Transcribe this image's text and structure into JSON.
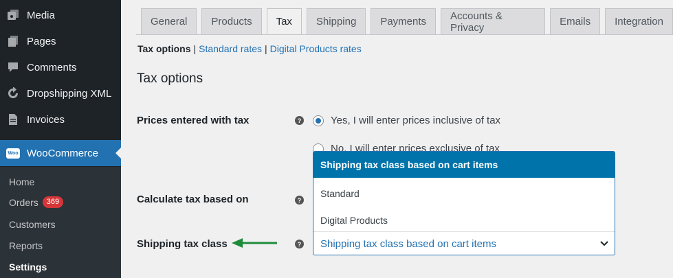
{
  "sidebar": {
    "items": [
      {
        "label": "Media",
        "icon": "media-icon"
      },
      {
        "label": "Pages",
        "icon": "pages-icon"
      },
      {
        "label": "Comments",
        "icon": "comments-icon"
      },
      {
        "label": "Dropshipping XML",
        "icon": "refresh-icon"
      },
      {
        "label": "Invoices",
        "icon": "document-icon"
      }
    ],
    "woocommerce": {
      "label": "WooCommerce",
      "logo_text": "Woo"
    },
    "submenu": [
      {
        "label": "Home"
      },
      {
        "label": "Orders",
        "badge": "369"
      },
      {
        "label": "Customers"
      },
      {
        "label": "Reports"
      },
      {
        "label": "Settings"
      }
    ]
  },
  "tabs": [
    "General",
    "Products",
    "Tax",
    "Shipping",
    "Payments",
    "Accounts & Privacy",
    "Emails",
    "Integration"
  ],
  "active_tab": "Tax",
  "subsub": {
    "current": "Tax options",
    "links": [
      "Standard rates",
      "Digital Products rates"
    ]
  },
  "section_title": "Tax options",
  "fields": {
    "prices_label": "Prices entered with tax",
    "prices_yes": "Yes, I will enter prices inclusive of tax",
    "prices_no": "No, I will enter prices exclusive of tax",
    "calc_label": "Calculate tax based on",
    "shipping_label": "Shipping tax class",
    "help_glyph": "?"
  },
  "dropdown": {
    "options": [
      "Shipping tax class based on cart items",
      "Standard",
      "Digital Products"
    ],
    "selected": "Shipping tax class based on cart items"
  },
  "colors": {
    "accent": "#2271b1",
    "highlight": "#0073aa",
    "arrow": "#1e8c3a",
    "badge": "#d63638"
  }
}
